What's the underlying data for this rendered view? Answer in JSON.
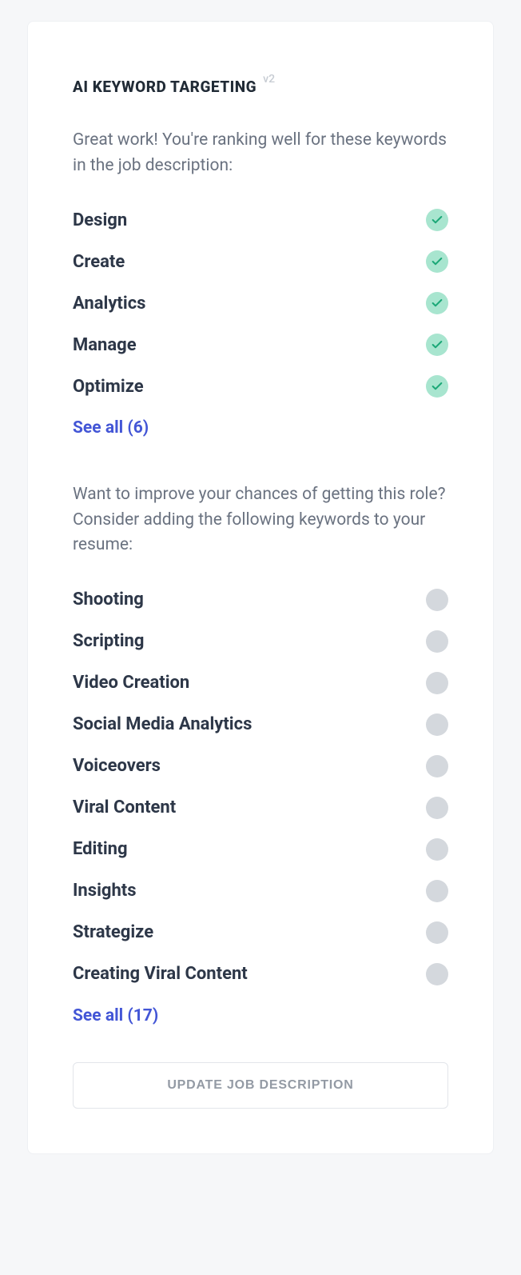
{
  "header": {
    "title": "AI KEYWORD TARGETING",
    "version": "v2"
  },
  "ranking": {
    "intro": "Great work! You're ranking well for these keywords in the job description:",
    "keywords": [
      {
        "label": "Design"
      },
      {
        "label": "Create"
      },
      {
        "label": "Analytics"
      },
      {
        "label": "Manage"
      },
      {
        "label": "Optimize"
      }
    ],
    "see_all": "See all (6)"
  },
  "suggested": {
    "intro": "Want to improve your chances of getting this role? Consider adding the following keywords to your resume:",
    "keywords": [
      {
        "label": "Shooting"
      },
      {
        "label": "Scripting"
      },
      {
        "label": "Video Creation"
      },
      {
        "label": "Social Media Analytics"
      },
      {
        "label": "Voiceovers"
      },
      {
        "label": "Viral Content"
      },
      {
        "label": "Editing"
      },
      {
        "label": "Insights"
      },
      {
        "label": "Strategize"
      },
      {
        "label": "Creating Viral Content"
      }
    ],
    "see_all": "See all (17)"
  },
  "actions": {
    "update_button": "UPDATE JOB DESCRIPTION"
  }
}
